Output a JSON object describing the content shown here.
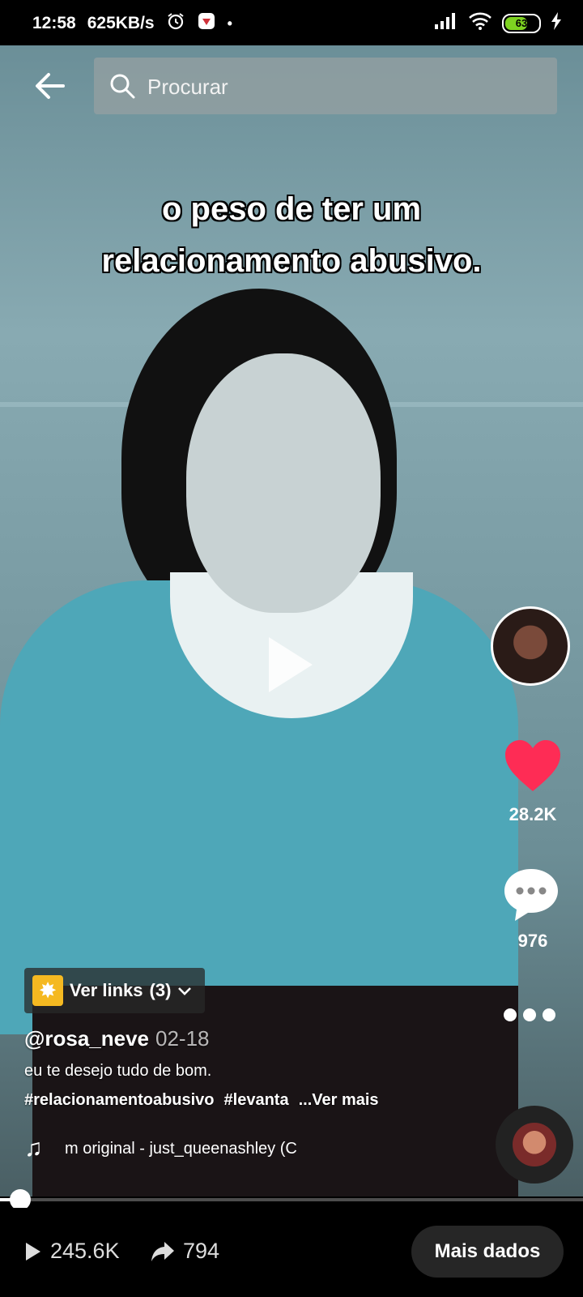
{
  "status_bar": {
    "time": "12:58",
    "network_speed": "625KB/s",
    "battery_level": "63",
    "icons": [
      "alarm-icon",
      "notification-app-icon",
      "signal-icon",
      "wifi-icon",
      "battery-icon",
      "charging-icon"
    ]
  },
  "header": {
    "search_placeholder": "Procurar"
  },
  "video": {
    "caption_line1": "o peso de ter um",
    "caption_line2": "relacionamento abusivo.",
    "progress": 0.03
  },
  "rail": {
    "like_count": "28.2K",
    "comment_count": "976"
  },
  "post": {
    "links_label": "Ver links",
    "links_count": "(3)",
    "username": "@rosa_neve",
    "date": "02-18",
    "description": "eu te desejo tudo de bom.",
    "hashtags": [
      "#relacionamentoabusivo",
      "#levanta"
    ],
    "see_more": "...Ver mais",
    "music": "m original - just_queenashley (C"
  },
  "bottom_bar": {
    "views": "245.6K",
    "shares": "794",
    "more_data_label": "Mais dados"
  },
  "colors": {
    "like": "#fe2c55",
    "links_icon": "#f5b921"
  }
}
